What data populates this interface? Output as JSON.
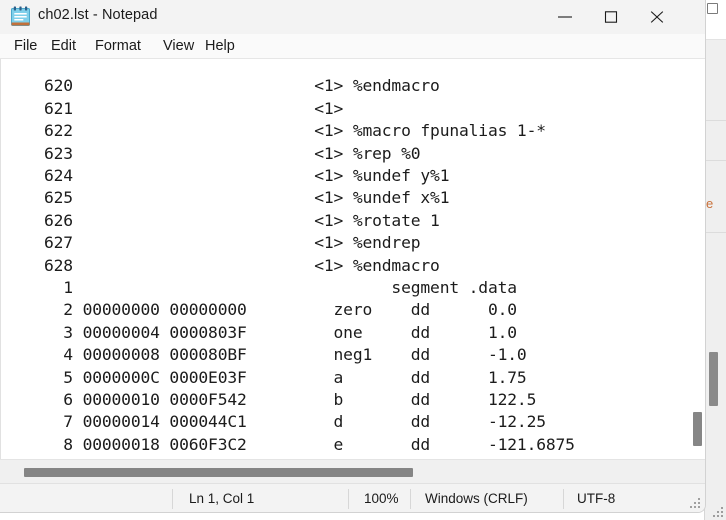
{
  "window": {
    "title": "ch02.lst - Notepad",
    "icon": "notepad-icon",
    "controls": {
      "minimize_label": "Minimize",
      "maximize_label": "Maximize",
      "close_label": "Close"
    }
  },
  "menubar": {
    "items": [
      {
        "label": "File"
      },
      {
        "label": "Edit"
      },
      {
        "label": "Format"
      },
      {
        "label": "View"
      },
      {
        "label": "Help"
      }
    ]
  },
  "editor": {
    "content": "   620                         <1> %endmacro\n   621                         <1>\n   622                         <1> %macro fpunalias 1-*\n   623                         <1> %rep %0\n   624                         <1> %undef y%1\n   625                         <1> %undef x%1\n   626                         <1> %rotate 1\n   627                         <1> %endrep\n   628                         <1> %endmacro\n     1                                 segment .data\n     2 00000000 00000000         zero    dd      0.0\n     3 00000004 0000803F         one     dd      1.0\n     4 00000008 000080BF         neg1    dd      -1.0\n     5 0000000C 0000E03F         a       dd      1.75\n     6 00000010 0000F542         b       dd      122.5\n     7 00000014 000044C1         d       dd      -12.25\n     8 00000018 0060F3C2         e       dd      -121.6875",
    "lines": [
      {
        "number": "620",
        "address": "",
        "bytes": "",
        "label": "",
        "directive": "",
        "operand": "",
        "rest": "<1> %endmacro"
      },
      {
        "number": "621",
        "address": "",
        "bytes": "",
        "label": "",
        "directive": "",
        "operand": "",
        "rest": "<1>"
      },
      {
        "number": "622",
        "address": "",
        "bytes": "",
        "label": "",
        "directive": "",
        "operand": "",
        "rest": "<1> %macro fpunalias 1-*"
      },
      {
        "number": "623",
        "address": "",
        "bytes": "",
        "label": "",
        "directive": "",
        "operand": "",
        "rest": "<1> %rep %0"
      },
      {
        "number": "624",
        "address": "",
        "bytes": "",
        "label": "",
        "directive": "",
        "operand": "",
        "rest": "<1> %undef y%1"
      },
      {
        "number": "625",
        "address": "",
        "bytes": "",
        "label": "",
        "directive": "",
        "operand": "",
        "rest": "<1> %undef x%1"
      },
      {
        "number": "626",
        "address": "",
        "bytes": "",
        "label": "",
        "directive": "",
        "operand": "",
        "rest": "<1> %rotate 1"
      },
      {
        "number": "627",
        "address": "",
        "bytes": "",
        "label": "",
        "directive": "",
        "operand": "",
        "rest": "<1> %endrep"
      },
      {
        "number": "628",
        "address": "",
        "bytes": "",
        "label": "",
        "directive": "",
        "operand": "",
        "rest": "<1> %endmacro"
      },
      {
        "number": "1",
        "address": "",
        "bytes": "",
        "label": "",
        "directive": "segment",
        "operand": ".data",
        "rest": ""
      },
      {
        "number": "2",
        "address": "00000000",
        "bytes": "00000000",
        "label": "zero",
        "directive": "dd",
        "operand": "0.0",
        "rest": ""
      },
      {
        "number": "3",
        "address": "00000004",
        "bytes": "0000803F",
        "label": "one",
        "directive": "dd",
        "operand": "1.0",
        "rest": ""
      },
      {
        "number": "4",
        "address": "00000008",
        "bytes": "000080BF",
        "label": "neg1",
        "directive": "dd",
        "operand": "-1.0",
        "rest": ""
      },
      {
        "number": "5",
        "address": "0000000C",
        "bytes": "0000E03F",
        "label": "a",
        "directive": "dd",
        "operand": "1.75",
        "rest": ""
      },
      {
        "number": "6",
        "address": "00000010",
        "bytes": "0000F542",
        "label": "b",
        "directive": "dd",
        "operand": "122.5",
        "rest": ""
      },
      {
        "number": "7",
        "address": "00000014",
        "bytes": "000044C1",
        "label": "d",
        "directive": "dd",
        "operand": "-12.25",
        "rest": ""
      },
      {
        "number": "8",
        "address": "00000018",
        "bytes": "0060F3C2",
        "label": "e",
        "directive": "dd",
        "operand": "-121.6875",
        "rest": ""
      }
    ]
  },
  "statusbar": {
    "line_column": "Ln 1, Col 1",
    "zoom": "100%",
    "line_ending": "Windows (CRLF)",
    "encoding": "UTF-8"
  },
  "background_window": {
    "visible_text": "e"
  },
  "colors": {
    "titlebar_bg": "#f3f3f3",
    "menubar_bg": "#fafafa",
    "editor_bg": "#ffffff",
    "text": "#1c1c1c",
    "statusbar_bg": "#f3f3f3",
    "scrollbar_thumb": "#868686",
    "icon_blue": "#6ec6e8",
    "icon_binding": "#2c5f8a",
    "icon_base": "#c2703a"
  }
}
